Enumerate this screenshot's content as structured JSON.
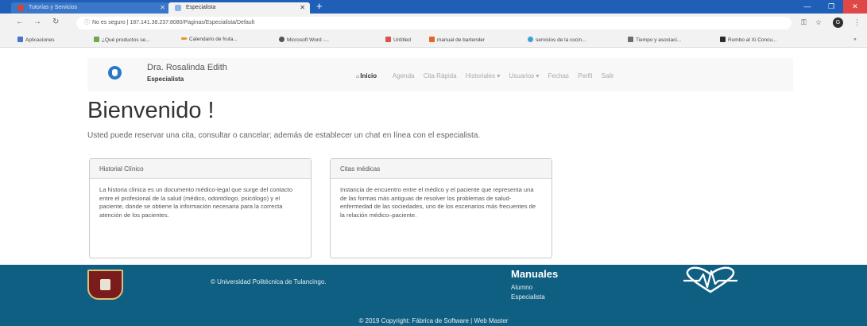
{
  "browser": {
    "tabs": [
      {
        "label": "Tutorías y Servicios",
        "active": false
      },
      {
        "label": "Especialista",
        "active": true
      }
    ],
    "url": "No es seguro  |  187.141.38.237:8080/Paginas/Especialista/Default",
    "bookmarks": [
      "Aplicaciones",
      "¿Qué productos se...",
      "Calendario de fruta...",
      "Microsoft Word -...",
      "Untitled",
      "manual de bartender",
      "servicios de la cocin...",
      "Tiempo y asociaci...",
      "Rumbo al Xi Concu..."
    ],
    "profile_initial": "G"
  },
  "navbar": {
    "brand": "Dra. Rosalinda Edith",
    "subtitle": "Especialista",
    "items": [
      "Inicio",
      "Agenda",
      "Cita Rápida",
      "Historiales ▾",
      "Usuarios ▾",
      "Fechas",
      "Perfil",
      "Salir"
    ]
  },
  "main": {
    "title": "Bienvenido !",
    "lead": "Usted puede reservar una cita, consultar o cancelar; además de establecer un chat en línea con el especialista.",
    "cards": [
      {
        "heading": "Historial Clínico",
        "body": "La historia clínica es un documento médico-legal que surge del contacto entre el profesional de la salud (médico, odontólogo, psicólogo) y el paciente, donde se obtiene la información necesaria para la correcta atención de los pacientes."
      },
      {
        "heading": "Citas médicas",
        "body": "Instancia de encuentro entre el médico y el paciente que representa una de las formas más antiguas de resolver los problemas de salud-enfermedad de las sociedades, uno de los escenarios más frecuentes de la relación médico–paciente."
      }
    ]
  },
  "footer": {
    "university": "© Universidad Politécnica de Tulancingo.",
    "manuals_title": "Manuales",
    "manual_links": [
      "Alumno",
      "Especialista"
    ],
    "copyright": "© 2019 Copyright: Fábrica de Software  |  Web Master"
  },
  "colors": {
    "footer": "#0f5f82",
    "tabbar": "#1f5fb7",
    "logo": "#2b78c9"
  }
}
